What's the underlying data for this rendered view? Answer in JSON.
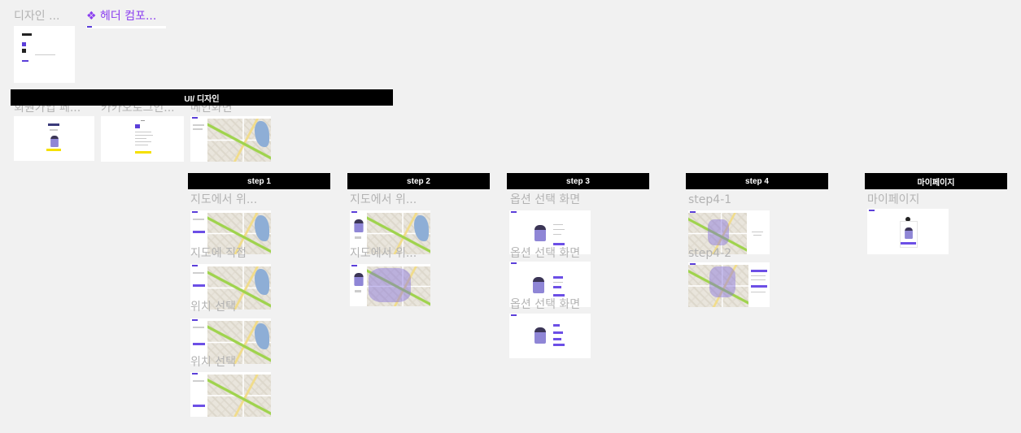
{
  "canvas": {
    "top_labels": {
      "design": "디자인 ...",
      "header_component": "❖ 헤더 컴포..."
    },
    "sections": {
      "ui_design": "UI/ 디자인",
      "step1": "step 1",
      "step2": "step 2",
      "step3": "step 3",
      "step4": "step 4",
      "mypage": "마이페이지"
    },
    "frames": {
      "signup": "회원가입 페...",
      "kakao_login": "카카오로그인...",
      "main": "메인화면",
      "step1_a": "지도에서 위...",
      "step1_b": "지도에 직접",
      "step1_c": "위치 선택",
      "step1_d": "위치 선택",
      "step2_a": "지도에서 위...",
      "step2_b": "지도에서 위...",
      "step3_a": "옵션 선택 화면",
      "step3_b": "옵션 선택 화면",
      "step3_c": "옵션 선택 화면",
      "step4_1": "step4-1",
      "step4_2": "step4-2",
      "mypage_frame": "마이페이지"
    }
  },
  "colors": {
    "canvas_bg": "#f1f1f1",
    "banner_bg": "#000000",
    "component": "#8b3ff0",
    "label": "#b3b3b3",
    "accent": "#6c4fe6"
  }
}
